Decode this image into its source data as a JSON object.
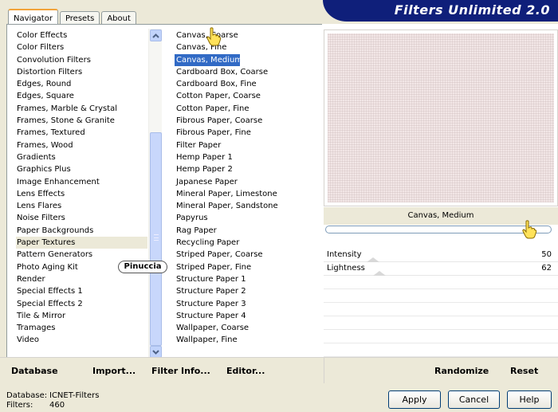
{
  "tabs": [
    {
      "label": "Navigator",
      "active": true
    },
    {
      "label": "Presets",
      "active": false
    },
    {
      "label": "About",
      "active": false
    }
  ],
  "app_title": "Filters Unlimited 2.0",
  "categories": [
    "Color Effects",
    "Color Filters",
    "Convolution Filters",
    "Distortion Filters",
    "Edges, Round",
    "Edges, Square",
    "Frames, Marble & Crystal",
    "Frames, Stone & Granite",
    "Frames, Textured",
    "Frames, Wood",
    "Gradients",
    "Graphics Plus",
    "Image Enhancement",
    "Lens Effects",
    "Lens Flares",
    "Noise Filters",
    "Paper Backgrounds",
    "Paper Textures",
    "Pattern Generators",
    "Photo Aging Kit",
    "Render",
    "Special Effects 1",
    "Special Effects 2",
    "Tile & Mirror",
    "Tramages",
    "Video"
  ],
  "selected_category": "Paper Textures",
  "filters": [
    "Canvas, Coarse",
    "Canvas, Fine",
    "Canvas, Medium",
    "Cardboard Box, Coarse",
    "Cardboard Box, Fine",
    "Cotton Paper, Coarse",
    "Cotton Paper, Fine",
    "Fibrous Paper, Coarse",
    "Fibrous Paper, Fine",
    "Filter Paper",
    "Hemp Paper 1",
    "Hemp Paper 2",
    "Japanese Paper",
    "Mineral Paper, Limestone",
    "Mineral Paper, Sandstone",
    "Papyrus",
    "Rag Paper",
    "Recycling Paper",
    "Striped Paper, Coarse",
    "Striped Paper, Fine",
    "Structure Paper 1",
    "Structure Paper 2",
    "Structure Paper 3",
    "Structure Paper 4",
    "Wallpaper, Coarse",
    "Wallpaper, Fine"
  ],
  "selected_filter": "Canvas, Medium",
  "preview": {
    "filter_name": "Canvas, Medium"
  },
  "params": [
    {
      "label": "Intensity",
      "value": "50"
    },
    {
      "label": "Lightness",
      "value": "62"
    }
  ],
  "toolbar": {
    "database": "Database",
    "import": "Import...",
    "filter_info": "Filter Info...",
    "editor": "Editor...",
    "randomize": "Randomize",
    "reset": "Reset"
  },
  "footer": {
    "database_label": "Database:",
    "database_value": "ICNET-Filters",
    "filters_label": "Filters:",
    "filters_value": "460"
  },
  "buttons": {
    "apply": "Apply",
    "cancel": "Cancel",
    "help": "Help"
  },
  "watermark": "Pinuccia",
  "colors": {
    "banner": "#0f1f7a",
    "selection": "#316ac5",
    "preview_tint": "#f2e6e6"
  }
}
